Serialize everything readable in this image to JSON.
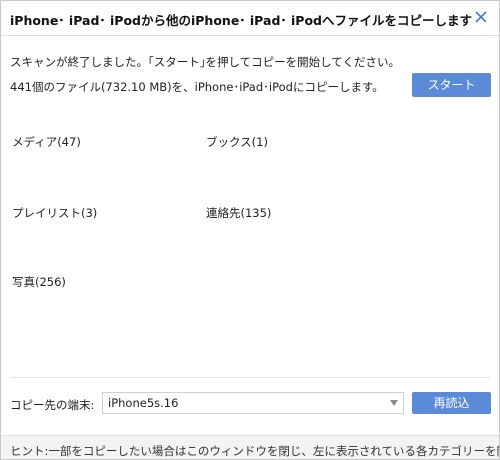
{
  "dialog": {
    "title": "iPhone･ iPad･ iPodから他のiPhone･ iPad･ iPodへファイルをコピーします",
    "close_glyph": "×"
  },
  "messages": {
    "scan_done": "スキャンが終了しました。｢スタート｣を押してコピーを開始してください。",
    "copy_summary": "441個のファイル(732.10 MB)を、iPhone･iPad･iPodにコピーします。"
  },
  "buttons": {
    "start": "スタート",
    "reload": "再読込"
  },
  "categories": {
    "media": "メディア(47)",
    "books": "ブックス(1)",
    "playlist": "プレイリスト(3)",
    "contacts": "連絡先(135)",
    "photos": "写真(256)"
  },
  "destination": {
    "label": "コピー先の端末:",
    "selected": "iPhone5s.16"
  },
  "hint": {
    "text": "ヒント:一部をコピーしたい場合はこのウィンドウを閉じ、左に表示されている各カテゴリーを開い"
  },
  "colors": {
    "button_bg": "#5b8bd8",
    "close_icon": "#4a78c8"
  },
  "icons": {
    "close": "close-icon",
    "dropdown": "chevron-down-icon"
  }
}
